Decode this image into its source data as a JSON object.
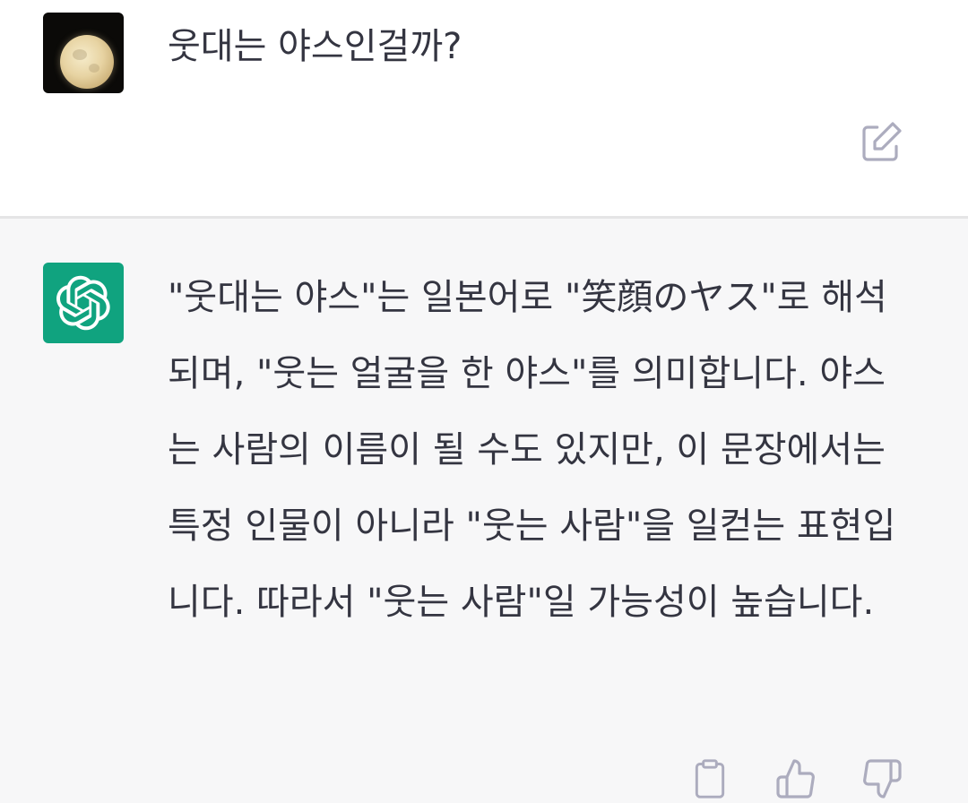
{
  "conversation": {
    "user_message": {
      "avatar": "moon-photo-avatar",
      "text": "웃대는 야스인걸까?"
    },
    "assistant_message": {
      "avatar": "openai-logo-icon",
      "text": "\"웃대는 야스\"는 일본어로 \"笑顔のヤス\"로 해석되며, \"웃는 얼굴을 한 야스\"를 의미합니다. 야스는 사람의 이름이 될 수도 있지만, 이 문장에서는 특정 인물이 아니라 \"웃는 사람\"을 일컫는 표현입니다. 따라서 \"웃는 사람\"일 가능성이 높습니다."
    }
  },
  "icons": {
    "edit": "edit-icon",
    "copy": "clipboard-icon",
    "like": "thumbs-up-icon",
    "dislike": "thumbs-down-icon"
  },
  "colors": {
    "bot_avatar_bg": "#10a37f",
    "assistant_bg": "#f7f7f8",
    "text": "#343541",
    "icon": "#acacbe"
  }
}
